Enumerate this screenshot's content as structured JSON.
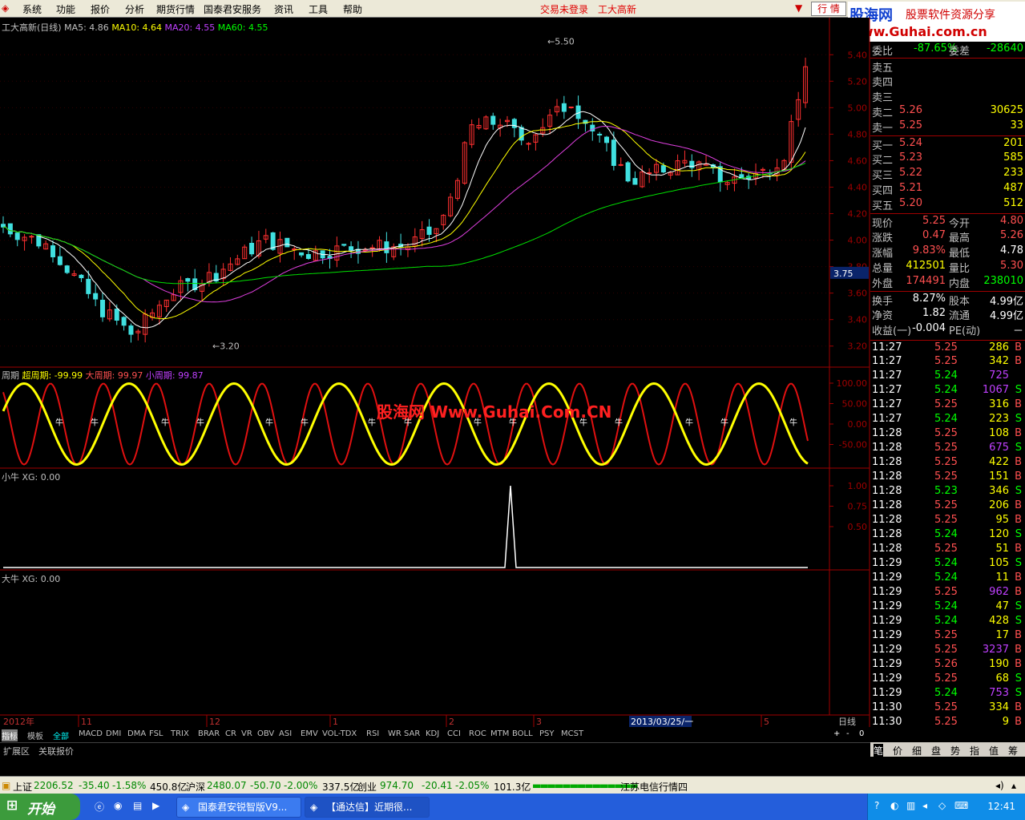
{
  "menu": {
    "items": [
      "系统",
      "功能",
      "报价",
      "分析",
      "期货行情",
      "国泰君安服务",
      "资讯",
      "工具",
      "帮助"
    ],
    "not_logged": "交易未登录",
    "stock_name": "工大高新",
    "hangqing_btn": "行 情"
  },
  "logo": {
    "line1": "股海网",
    "line1b": "股票软件资源分享",
    "line2": "www.Guhai.com.cn"
  },
  "main_header": {
    "title": "工大高新(日线)",
    "ma5": "MA5: 4.86",
    "ma10": "MA10: 4.64",
    "ma20": "MA20: 4.55",
    "ma60": "MA60: 4.55"
  },
  "price_axis": [
    "5.40",
    "5.20",
    "5.00",
    "4.80",
    "4.60",
    "4.40",
    "4.20",
    "4.00",
    "3.80",
    "3.60",
    "3.40",
    "3.20"
  ],
  "price_marker": "3.75",
  "annotations": {
    "high": "5.50",
    "low": "3.20"
  },
  "cycle_header": {
    "title": "周期",
    "super": "超周期: -99.99",
    "big": "大周期: 99.97",
    "small": "小周期: 99.87"
  },
  "cycle_axis": [
    "100.00",
    "50.00",
    "0.00",
    "-50.00"
  ],
  "cycle_marker": "牛",
  "watermark": "股海网 Www.Guhai.Com.CN",
  "xiaoniu_header": "小牛  XG: 0.00",
  "xiaoniu_axis": [
    "1.00",
    "0.75",
    "0.50"
  ],
  "daniu_header": "大牛  XG: 0.00",
  "date_axis": {
    "year": "2012年",
    "labels": [
      "11",
      "12",
      "1",
      "2",
      "3",
      "5"
    ],
    "cursor": "2013/03/25/一",
    "mode": "日线"
  },
  "quote": {
    "weibi": {
      "label1": "委比",
      "v1": "-87.65%",
      "label2": "委差",
      "v2": "-28640"
    },
    "sell": [
      {
        "l": "卖五",
        "p": "",
        "v": ""
      },
      {
        "l": "卖四",
        "p": "",
        "v": ""
      },
      {
        "l": "卖三",
        "p": "",
        "v": ""
      },
      {
        "l": "卖二",
        "p": "5.26",
        "v": "30625"
      },
      {
        "l": "卖一",
        "p": "5.25",
        "v": "33"
      }
    ],
    "buy": [
      {
        "l": "买一",
        "p": "5.24",
        "v": "201"
      },
      {
        "l": "买二",
        "p": "5.23",
        "v": "585"
      },
      {
        "l": "买三",
        "p": "5.22",
        "v": "233"
      },
      {
        "l": "买四",
        "p": "5.21",
        "v": "487"
      },
      {
        "l": "买五",
        "p": "5.20",
        "v": "512"
      }
    ],
    "stats": [
      {
        "l1": "现价",
        "v1": "5.25",
        "l2": "今开",
        "v2": "4.80"
      },
      {
        "l1": "涨跌",
        "v1": "0.47",
        "l2": "最高",
        "v2": "5.26"
      },
      {
        "l1": "涨幅",
        "v1": "9.83%",
        "l2": "最低",
        "v2": "4.78"
      },
      {
        "l1": "总量",
        "v1": "412501",
        "l2": "量比",
        "v2": "5.30"
      },
      {
        "l1": "外盘",
        "v1": "174491",
        "l2": "内盘",
        "v2": "238010"
      }
    ],
    "stats2": [
      {
        "l1": "换手",
        "v1": "8.27%",
        "l2": "股本",
        "v2": "4.99亿"
      },
      {
        "l1": "净资",
        "v1": "1.82",
        "l2": "流通",
        "v2": "4.99亿"
      },
      {
        "l1": "收益(一)",
        "v1": "-0.004",
        "l2": "PE(动)",
        "v2": "－"
      }
    ],
    "ticks": [
      [
        "11:27",
        "5.25",
        "286",
        "B"
      ],
      [
        "11:27",
        "5.25",
        "342",
        "B"
      ],
      [
        "11:27",
        "5.24",
        "725",
        ""
      ],
      [
        "11:27",
        "5.24",
        "1067",
        "S"
      ],
      [
        "11:27",
        "5.25",
        "316",
        "B"
      ],
      [
        "11:27",
        "5.24",
        "223",
        "S"
      ],
      [
        "11:28",
        "5.25",
        "108",
        "B"
      ],
      [
        "11:28",
        "5.25",
        "675",
        "S"
      ],
      [
        "11:28",
        "5.25",
        "422",
        "B"
      ],
      [
        "11:28",
        "5.25",
        "151",
        "B"
      ],
      [
        "11:28",
        "5.23",
        "346",
        "S"
      ],
      [
        "11:28",
        "5.25",
        "206",
        "B"
      ],
      [
        "11:28",
        "5.25",
        "95",
        "B"
      ],
      [
        "11:28",
        "5.24",
        "120",
        "S"
      ],
      [
        "11:28",
        "5.25",
        "51",
        "B"
      ],
      [
        "11:29",
        "5.24",
        "105",
        "S"
      ],
      [
        "11:29",
        "5.24",
        "11",
        "B"
      ],
      [
        "11:29",
        "5.25",
        "962",
        "B"
      ],
      [
        "11:29",
        "5.24",
        "47",
        "S"
      ],
      [
        "11:29",
        "5.24",
        "428",
        "S"
      ],
      [
        "11:29",
        "5.25",
        "17",
        "B"
      ],
      [
        "11:29",
        "5.25",
        "3237",
        "B"
      ],
      [
        "11:29",
        "5.26",
        "190",
        "B"
      ],
      [
        "11:29",
        "5.25",
        "68",
        "S"
      ],
      [
        "11:29",
        "5.24",
        "753",
        "S"
      ],
      [
        "11:30",
        "5.25",
        "334",
        "B"
      ],
      [
        "11:30",
        "5.25",
        "9",
        "B"
      ]
    ]
  },
  "indicator_tabs": [
    "指标",
    "模板",
    "全部",
    "MACD",
    "DMI",
    "DMA",
    "FSL",
    "TRIX",
    "BRAR",
    "CR",
    "VR",
    "OBV",
    "ASI",
    "EMV",
    "VOL-TDX",
    "RSI",
    "WR",
    "SAR",
    "KDJ",
    "CCI",
    "ROC",
    "MTM",
    "BOLL",
    "PSY",
    "MCST"
  ],
  "bottom_tabs": [
    "扩展区",
    "关联报价"
  ],
  "right_tabs": [
    "笔",
    "价",
    "细",
    "盘",
    "势",
    "指",
    "值",
    "筹"
  ],
  "status": {
    "sh_label": "上证",
    "sh": "2206.52",
    "sh_chg": "-35.40",
    "sh_pct": "-1.58%",
    "sh_amt": "450.8亿",
    "sz_label": "沪深",
    "sz": "2480.07",
    "sz_chg": "-50.70",
    "sz_pct": "-2.00%",
    "sz_amt": "337.5亿",
    "cy_label": "创业",
    "cy": "974.70",
    "cy_chg": "-20.41",
    "cy_pct": "-2.05%",
    "cy_amt": "101.3亿",
    "news": "江苏电信行情四"
  },
  "taskbar": {
    "start": "开始",
    "tasks": [
      "国泰君安锐智版V9...",
      "【通达信】近期很..."
    ],
    "clock": "12:41"
  },
  "chart_data": {
    "type": "candlestick",
    "title": "工大高新(日线)",
    "series": [
      {
        "name": "MA5",
        "value": 4.86
      },
      {
        "name": "MA10",
        "value": 4.64
      },
      {
        "name": "MA20",
        "value": 4.55
      },
      {
        "name": "MA60",
        "value": 4.55
      }
    ],
    "ylim": [
      3.15,
      5.55
    ],
    "high": 5.5,
    "low": 3.2,
    "last": 5.25
  }
}
